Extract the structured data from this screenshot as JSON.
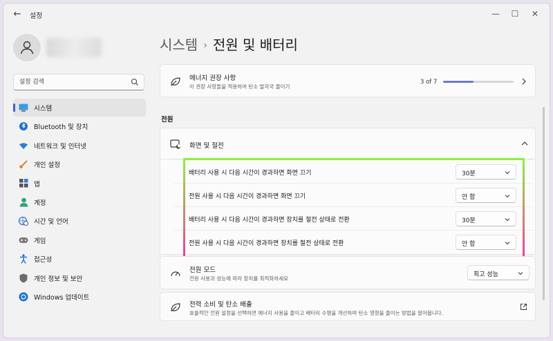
{
  "window": {
    "app_title": "설정",
    "controls": {
      "minimize": "—",
      "maximize": "☐",
      "close": "✕"
    }
  },
  "sidebar": {
    "search_placeholder": "설정 검색",
    "items": [
      {
        "label": "시스템",
        "icon": "monitor-icon",
        "selected": true
      },
      {
        "label": "Bluetooth 및 장치",
        "icon": "bluetooth-icon"
      },
      {
        "label": "네트워크 및 인터넷",
        "icon": "wifi-icon"
      },
      {
        "label": "개인 설정",
        "icon": "brush-icon"
      },
      {
        "label": "앱",
        "icon": "apps-icon"
      },
      {
        "label": "계정",
        "icon": "account-icon"
      },
      {
        "label": "시간 및 언어",
        "icon": "globe-clock-icon"
      },
      {
        "label": "게임",
        "icon": "gamepad-icon"
      },
      {
        "label": "접근성",
        "icon": "accessibility-icon"
      },
      {
        "label": "개인 정보 및 보안",
        "icon": "shield-icon"
      },
      {
        "label": "Windows 업데이트",
        "icon": "update-icon"
      }
    ]
  },
  "breadcrumb": {
    "parent": "시스템",
    "separator": "›",
    "current": "전원 및 배터리"
  },
  "recommendations": {
    "title": "에너지 권장 사항",
    "subtitle": "이 권장 사항들을 적용하여 탄소 발자국 줄이기",
    "counter": "3 of 7",
    "progress": 0.43
  },
  "section_label": "전원",
  "screen_sleep": {
    "title": "화면 및 절전",
    "rows": [
      {
        "label": "배터리 사용 시 다음 시간이 경과하면 화면 끄기",
        "value": "30분"
      },
      {
        "label": "전원 사용 시 다음 시간이 경과하면 화면 끄기",
        "value": "안 함"
      },
      {
        "label": "배터리 사용 시 다음 시간이 경과하면 장치를 절전 상태로 전환",
        "value": "30분"
      },
      {
        "label": "전원 사용 시 다음 시간이 경과하면 장치를 절전 상태로 전환",
        "value": "안 함"
      }
    ]
  },
  "power_mode": {
    "title": "전원 모드",
    "subtitle": "전원 사용과 성능에 따라 장치를 최적화하세요",
    "value": "최고 성능"
  },
  "power_usage": {
    "title": "전력 소비 및 탄소 배출",
    "subtitle": "효율적인 전원 설정을 선택하면 에너지 사용을 줄이고 배터리 수명을 개선하며 탄소 영향을 줄이는 방법을 알아봅니다."
  },
  "colors": {
    "accent": "#3d62c7",
    "highlight_top": "#8ef03c",
    "highlight_bottom": "#f23c9a"
  }
}
